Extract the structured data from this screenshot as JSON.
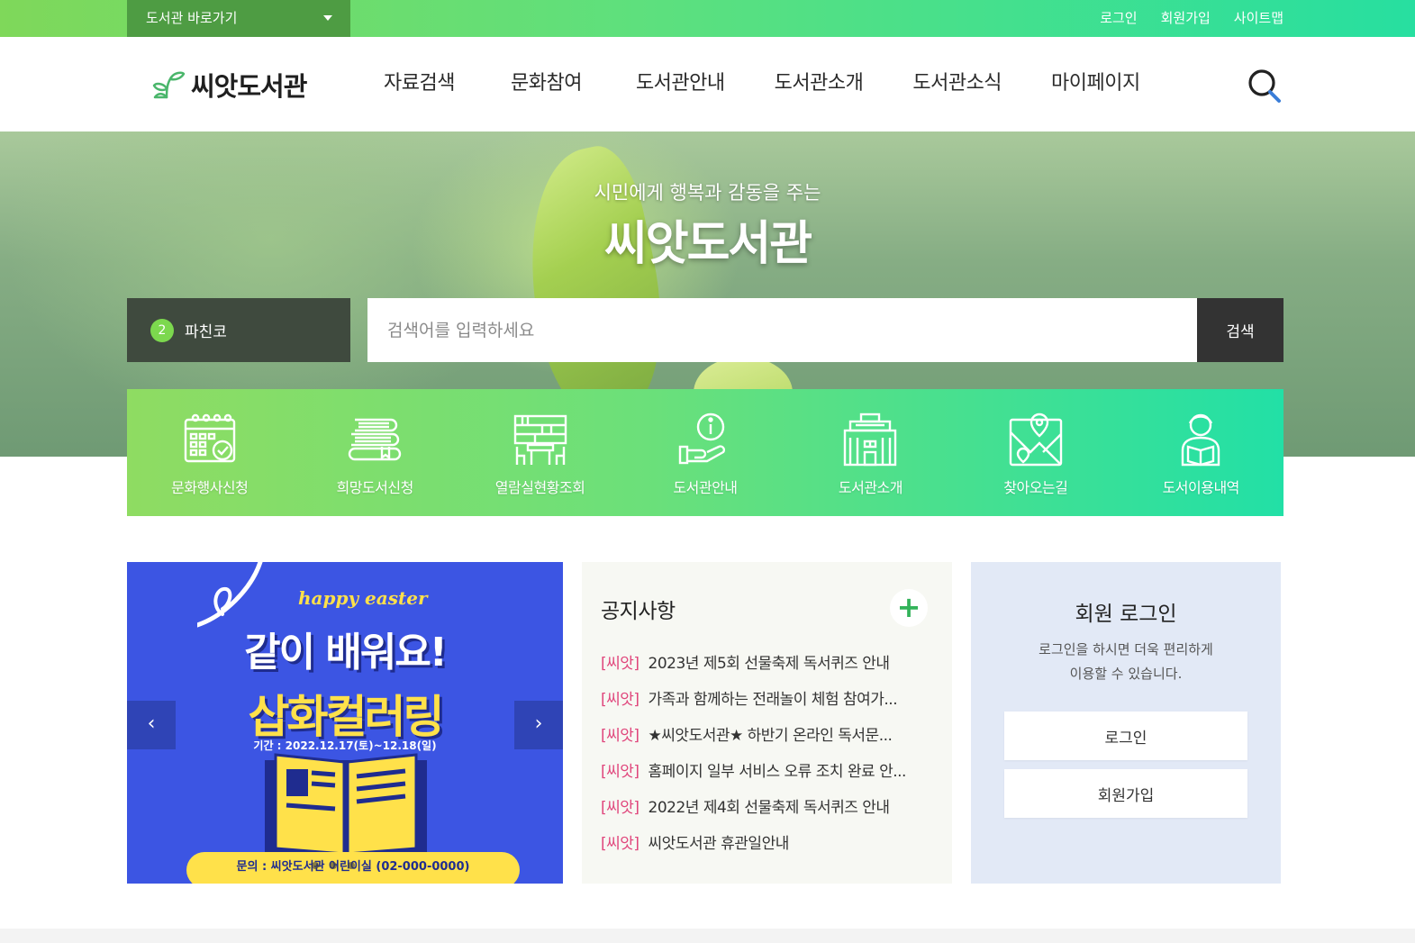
{
  "topbar": {
    "quick_link_label": "도서관 바로가기",
    "links": [
      "로그인",
      "회원가입",
      "사이트맵"
    ],
    "gradient": [
      "#7fd85a",
      "#27dfa0"
    ],
    "quick_link_bg": "#4e9c43"
  },
  "header": {
    "logo_text": "씨앗도서관",
    "nav": [
      "자료검색",
      "문화참여",
      "도서관안내",
      "도서관소개",
      "도서관소식",
      "마이페이지"
    ]
  },
  "hero": {
    "subtitle": "시민에게 행복과 감동을 주는",
    "title": "씨앗도서관"
  },
  "search": {
    "badge_number": "2",
    "selected_library": "파친코",
    "placeholder": "검색어를 입력하세요",
    "button_label": "검색"
  },
  "quick_menu": [
    {
      "label": "문화행사신청",
      "icon": "calendar-check-icon"
    },
    {
      "label": "희망도서신청",
      "icon": "book-stack-icon"
    },
    {
      "label": "열람실현황조회",
      "icon": "reading-room-icon"
    },
    {
      "label": "도서관안내",
      "icon": "hand-info-icon"
    },
    {
      "label": "도서관소개",
      "icon": "building-icon"
    },
    {
      "label": "찾아오는길",
      "icon": "map-pin-icon"
    },
    {
      "label": "도서이용내역",
      "icon": "reader-icon"
    }
  ],
  "banner": {
    "tagline": "happy easter",
    "headline": "같이 배워요!",
    "title": "삽화컬러링",
    "period": "기간 : 2022.12.17(토)~12.18(일)",
    "contact": "문의 : 씨앗도서관 어린이실 (02-000-0000)",
    "bg_color": "#3c55e3",
    "accent_color": "#ffe14a"
  },
  "notice": {
    "title": "공지사항",
    "more_label": "+",
    "items": [
      {
        "tag": "[씨앗]",
        "text": "2023년 제5회 선물축제 독서퀴즈 안내"
      },
      {
        "tag": "[씨앗]",
        "text": "가족과 함께하는 전래놀이 체험 참여가..."
      },
      {
        "tag": "[씨앗]",
        "text": "★씨앗도서관★ 하반기 온라인 독서문..."
      },
      {
        "tag": "[씨앗]",
        "text": "홈페이지 일부 서비스 오류 조치 완료 안..."
      },
      {
        "tag": "[씨앗]",
        "text": "2022년 제4회 선물축제 독서퀴즈 안내"
      },
      {
        "tag": "[씨앗]",
        "text": "씨앗도서관 휴관일안내"
      }
    ]
  },
  "login": {
    "title": "회원 로그인",
    "desc_line1": "로그인을 하시면 더욱 편리하게",
    "desc_line2": "이용할 수 있습니다.",
    "login_button": "로그인",
    "join_button": "회원가입"
  }
}
